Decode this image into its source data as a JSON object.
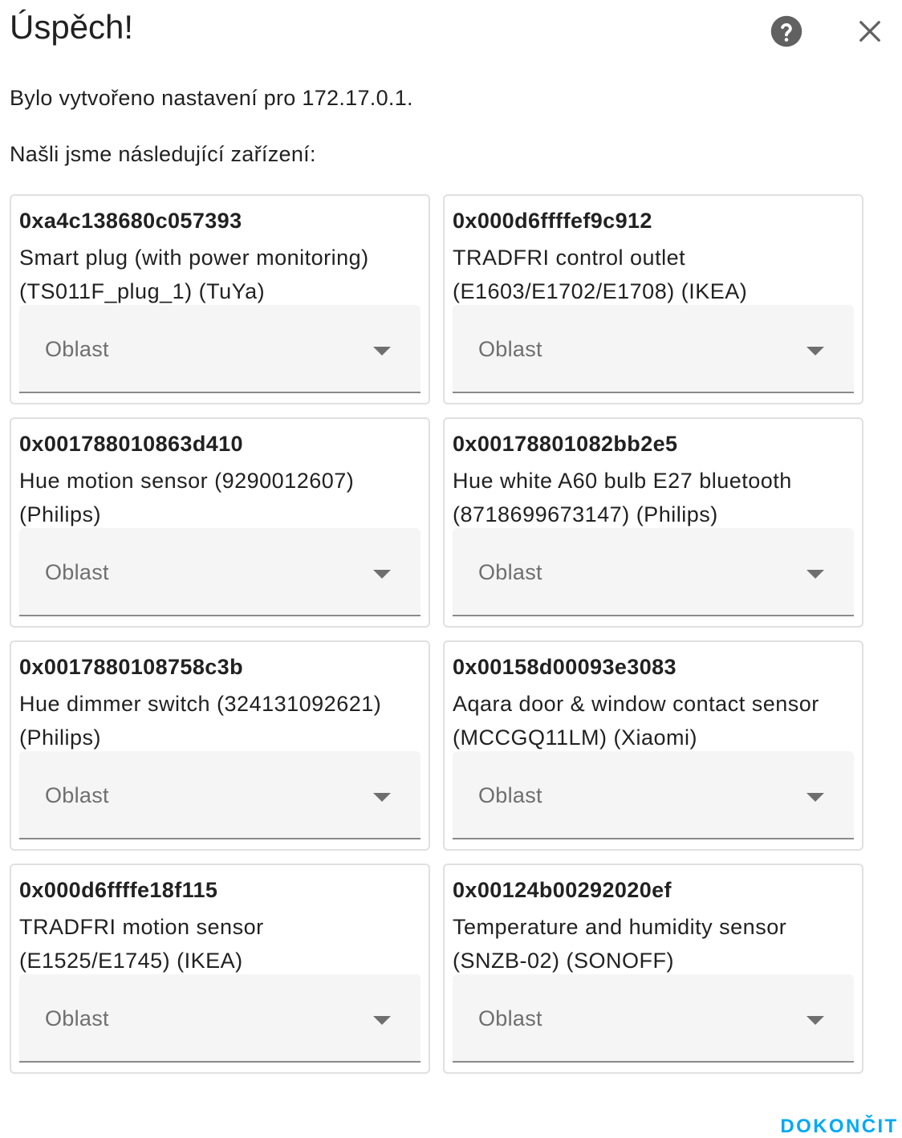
{
  "dialog": {
    "title": "Úspěch!",
    "help_icon": "help-circle-icon",
    "close_icon": "close-icon",
    "created_message": "Bylo vytvořeno nastavení pro 172.17.0.1.",
    "found_message": "Našli jsme následující zařízení:",
    "finish_label": "DOKONČIT",
    "accent_color": "#03a9f4"
  },
  "devices": [
    {
      "id": "0xa4c138680c057393",
      "description": "Smart plug (with power monitoring) (TS011F_plug_1) (TuYa)",
      "area_label": "Oblast"
    },
    {
      "id": "0x000d6ffffef9c912",
      "description": "TRADFRI control outlet (E1603/E1702/E1708) (IKEA)",
      "area_label": "Oblast"
    },
    {
      "id": "0x001788010863d410",
      "description": "Hue motion sensor (9290012607) (Philips)",
      "area_label": "Oblast"
    },
    {
      "id": "0x00178801082bb2e5",
      "description": "Hue white A60 bulb E27 bluetooth (8718699673147) (Philips)",
      "area_label": "Oblast"
    },
    {
      "id": "0x0017880108758c3b",
      "description": "Hue dimmer switch (324131092621) (Philips)",
      "area_label": "Oblast"
    },
    {
      "id": "0x00158d00093e3083",
      "description": "Aqara door & window contact sensor (MCCGQ11LM) (Xiaomi)",
      "area_label": "Oblast"
    },
    {
      "id": "0x000d6ffffe18f115",
      "description": "TRADFRI motion sensor (E1525/E1745) (IKEA)",
      "area_label": "Oblast"
    },
    {
      "id": "0x00124b00292020ef",
      "description": "Temperature and humidity sensor (SNZB-02) (SONOFF)",
      "area_label": "Oblast"
    }
  ]
}
